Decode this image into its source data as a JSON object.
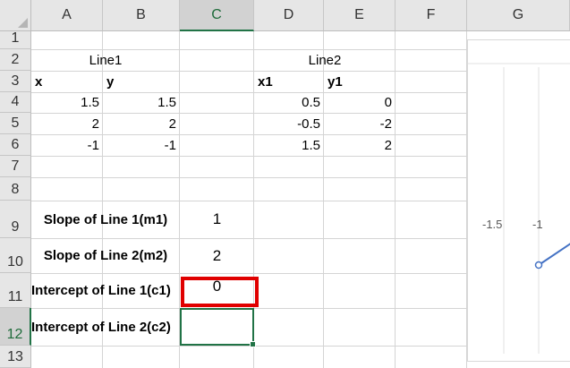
{
  "sheet": {
    "columns": [
      "A",
      "B",
      "C",
      "D",
      "E",
      "F",
      "G"
    ],
    "selected_column": "C",
    "rows": [
      "1",
      "2",
      "3",
      "4",
      "5",
      "6",
      "7",
      "8",
      "9",
      "10",
      "11",
      "12",
      "13"
    ],
    "selected_row": "12",
    "cells": {
      "A2": "Line1",
      "A3": "x",
      "B3": "y",
      "A4": "1.5",
      "B4": "1.5",
      "A5": "2",
      "B5": "2",
      "A6": "-1",
      "B6": "-1",
      "D2": "Line2",
      "D3": "x1",
      "E3": "y1",
      "D4": "0.5",
      "E4": "0",
      "D5": "-0.5",
      "E5": "-2",
      "D6": "1.5",
      "E6": "2",
      "A9": "Slope of Line 1(m1)",
      "C9": "1",
      "A10": "Slope of Line 2(m2)",
      "C10": "2",
      "A11": "Intercept of Line 1(c1)",
      "C11": "0",
      "A12": "Intercept of Line 2(c2)",
      "C12": ""
    },
    "active_cell": "C12",
    "highlighted_cell": "C11",
    "highlight_color": "#e00000",
    "accent_color": "#217346"
  },
  "chart": {
    "x_tick_labels": [
      "-1.5",
      "-1"
    ],
    "series_color": "#4472c4"
  }
}
